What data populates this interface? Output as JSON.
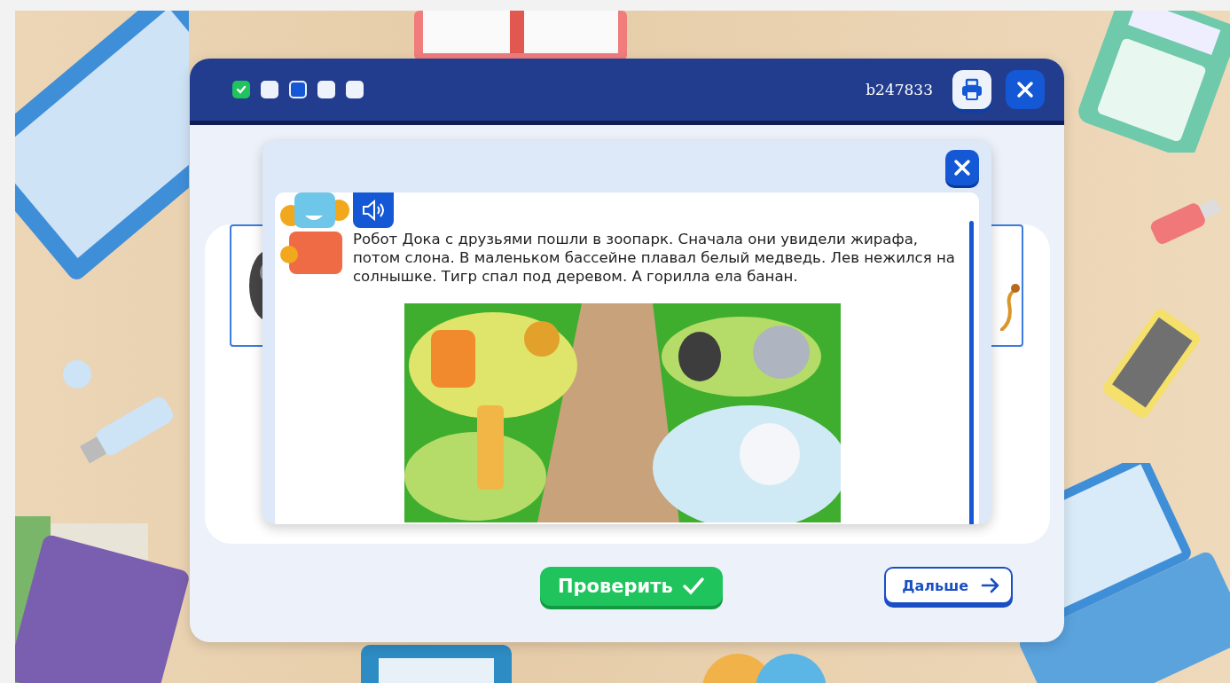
{
  "header": {
    "steps": [
      {
        "checked": true,
        "selected": false
      },
      {
        "checked": false,
        "selected": false
      },
      {
        "checked": false,
        "selected": true
      },
      {
        "checked": false,
        "selected": false
      },
      {
        "checked": false,
        "selected": false
      }
    ],
    "task_id": "b247833"
  },
  "popup": {
    "text": "Робот Дока с друзьями пошли в зоопарк. Сначала они увидели жирафа, потом слона. В маленьком бассейне плавал белый медведь. Лев нежился на солнышке. Тигр спал под деревом. А горилла ела банан."
  },
  "buttons": [
    {
      "label": "Проверить",
      "kind": "check"
    },
    {
      "label": "Дальше",
      "kind": "next"
    }
  ]
}
